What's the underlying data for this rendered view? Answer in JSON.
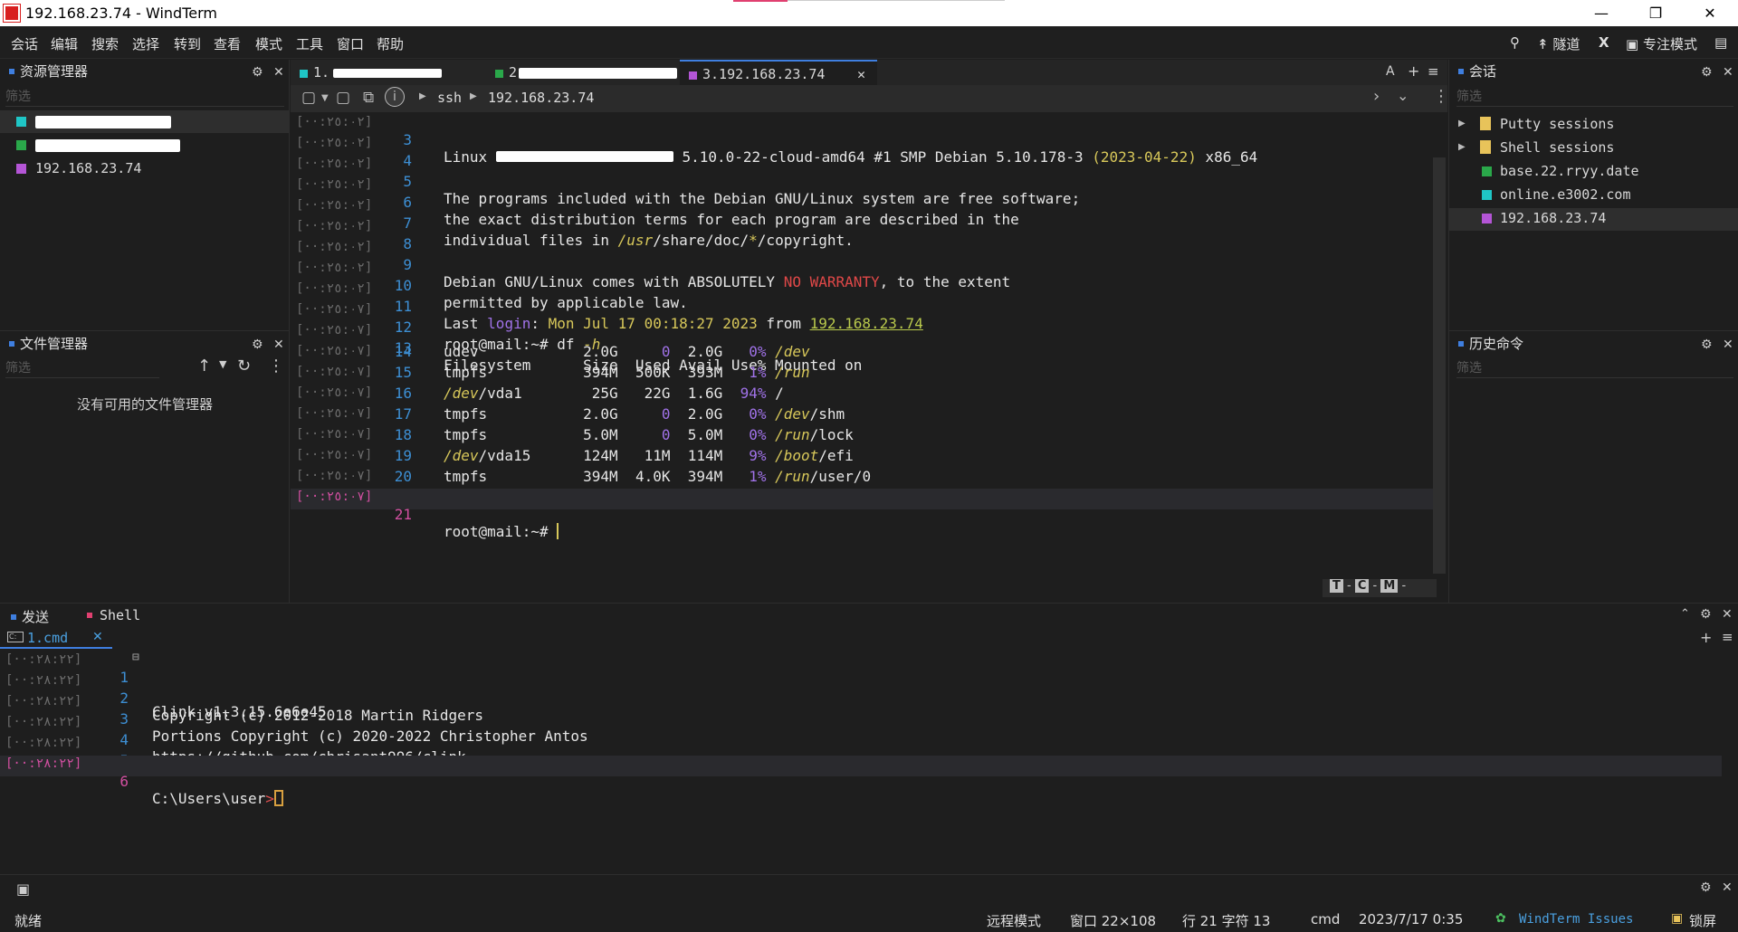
{
  "window": {
    "title": "192.168.23.74 - WindTerm"
  },
  "menu": [
    "会话",
    "编辑",
    "搜索",
    "选择",
    "转到",
    "查看",
    "模式",
    "工具",
    "窗口",
    "帮助"
  ],
  "toolbar": {
    "tunnel": "隧道",
    "x": "X",
    "focus_mode": "专注模式"
  },
  "explorer": {
    "title": "资源管理器",
    "filter": "筛选",
    "items": [
      {
        "label": "",
        "color": "#1fc6c6"
      },
      {
        "label": "",
        "color": "#2aa84a"
      },
      {
        "label": "192.168.23.74",
        "color": "#b455d6"
      }
    ]
  },
  "file_manager": {
    "title": "文件管理器",
    "filter": "筛选",
    "empty": "没有可用的文件管理器"
  },
  "tabs": [
    {
      "label": "1.",
      "color": "#1fc6c6"
    },
    {
      "label": "2",
      "color": "#2aa84a"
    },
    {
      "label": "3.192.168.23.74",
      "color": "#b455d6"
    }
  ],
  "tab_actions": {
    "font": "A",
    "add": "+",
    "menu": "≡",
    "close": "✕"
  },
  "breadcrumb": {
    "protocol": "ssh",
    "host": "192.168.23.74"
  },
  "terminal": {
    "lines": [
      {
        "ts": "[··:٢٥:٠٢]",
        "n": "3"
      },
      {
        "ts": "[··:٢٥:٠٢]",
        "n": "4"
      },
      {
        "ts": "[··:٢٥:٠٢]",
        "n": "5",
        "text": "The programs included with the Debian GNU/Linux system are free software;"
      },
      {
        "ts": "[··:٢٥:٠٢]",
        "n": "6",
        "text": "the exact distribution terms for each program are described in the"
      },
      {
        "ts": "[··:٢٥:٠٢]",
        "n": "7"
      },
      {
        "ts": "[··:٢٥:٠٢]",
        "n": "8"
      },
      {
        "ts": "[··:٢٥:٠٢]",
        "n": "9"
      },
      {
        "ts": "[··:٢٥:٠٢]",
        "n": "10",
        "text": "permitted by applicable law."
      },
      {
        "ts": "[··:٢٥:٠٢]",
        "n": "11"
      },
      {
        "ts": "[··:٢٥:٠٧]",
        "n": "12"
      },
      {
        "ts": "[··:٢٥:٠٧]",
        "n": "13",
        "text": "Filesystem      Size  Used Avail Use% Mounted on"
      },
      {
        "ts": "[··:٢٥:٠٧]",
        "n": "14"
      },
      {
        "ts": "[··:٢٥:٠٧]",
        "n": "15"
      },
      {
        "ts": "[··:٢٥:٠٧]",
        "n": "16"
      },
      {
        "ts": "[··:٢٥:٠٧]",
        "n": "17"
      },
      {
        "ts": "[··:٢٥:٠٧]",
        "n": "18"
      },
      {
        "ts": "[··:٢٥:٠٧]",
        "n": "19"
      },
      {
        "ts": "[··:٢٥:٠٧]",
        "n": "20"
      },
      {
        "ts": "[··:٢٥:٠٧]",
        "n": "21",
        "text": "root@mail:~# "
      }
    ],
    "linux_line": {
      "pre": "Linux",
      "kernel": "5.10.0-22-cloud-amd64",
      "build": "#1",
      "smp": "SMP Debian 5.10.178-3",
      "date": "(2023-04-22)",
      "arch": "x86_64"
    },
    "line7": {
      "a": "individual files in ",
      "b": "/usr",
      "c": "/share/doc/",
      "d": "*",
      "e": "/copyright."
    },
    "line9": {
      "a": "Debian GNU/Linux comes with ABSOLUTELY ",
      "b": "NO WARRANTY",
      "c": ", to the extent"
    },
    "line11": {
      "a": "Last ",
      "b": "login",
      "c": ": ",
      "d": "Mon Jul 17 00:18:27 2023",
      "e": " from ",
      "f": "192.168.23.74"
    },
    "line12": {
      "a": "root@mail:~# df ",
      "b": "-h"
    },
    "df_rows": [
      {
        "fs1": "udev",
        "fs2": "",
        "size": "2.0G",
        "used": "0",
        "avail": "2.0G",
        "use": "0%",
        "m1": "/dev",
        "m2": ""
      },
      {
        "fs1": "tmpfs",
        "fs2": "",
        "size": "394M",
        "used": "500K",
        "avail": "393M",
        "use": "1%",
        "m1": "/run",
        "m2": ""
      },
      {
        "fs1": "/dev",
        "fs2": "/vda1",
        "size": "25G",
        "used": "22G",
        "avail": "1.6G",
        "use": "94%",
        "m1": "",
        "m2": "/"
      },
      {
        "fs1": "tmpfs",
        "fs2": "",
        "size": "2.0G",
        "used": "0",
        "avail": "2.0G",
        "use": "0%",
        "m1": "/dev",
        "m2": "/shm"
      },
      {
        "fs1": "tmpfs",
        "fs2": "",
        "size": "5.0M",
        "used": "0",
        "avail": "5.0M",
        "use": "0%",
        "m1": "/run",
        "m2": "/lock"
      },
      {
        "fs1": "/dev",
        "fs2": "/vda15",
        "size": "124M",
        "used": "11M",
        "avail": "114M",
        "use": "9%",
        "m1": "/boot",
        "m2": "/efi"
      },
      {
        "fs1": "tmpfs",
        "fs2": "",
        "size": "394M",
        "used": "4.0K",
        "avail": "394M",
        "use": "1%",
        "m1": "/run",
        "m2": "/user/0"
      }
    ],
    "mode_letters": [
      "T",
      "C",
      "M"
    ]
  },
  "sessions": {
    "title": "会话",
    "filter": "筛选",
    "groups": [
      "Putty sessions",
      "Shell sessions"
    ],
    "items": [
      {
        "label": "base.22.rryy.date",
        "color": "#2aa84a"
      },
      {
        "label": "online.e3002.com",
        "color": "#1fc6c6"
      },
      {
        "label": "192.168.23.74",
        "color": "#b455d6"
      }
    ]
  },
  "history": {
    "title": "历史命令",
    "filter": "筛选"
  },
  "bottom": {
    "tabs": [
      "发送",
      "Shell"
    ],
    "file_tab": "1.cmd",
    "lines": [
      {
        "ts": "[··:٢٨:٢٢]",
        "n": "1",
        "text": "Clink v1.3.15.6e6e45"
      },
      {
        "ts": "[··:٢٨:٢٢]",
        "n": "2",
        "text": "Copyright (c) 2012-2018 Martin Ridgers"
      },
      {
        "ts": "[··:٢٨:٢٢]",
        "n": "3",
        "text": "Portions Copyright (c) 2020-2022 Christopher Antos"
      },
      {
        "ts": "[··:٢٨:٢٢]",
        "n": "4",
        "text": "https://github.com/chrisant996/clink"
      },
      {
        "ts": "[··:٢٨:٢٢]",
        "n": "5",
        "text": ""
      },
      {
        "ts": "[··:٢٨:٢٢]",
        "n": "6",
        "text": "C:\\Users\\user"
      }
    ],
    "prompt_char": ">"
  },
  "status": {
    "ready": "就绪",
    "remote_mode": "远程模式",
    "window_size": "窗口 22×108",
    "position": "行 21 字符 13",
    "shell": "cmd",
    "datetime": "2023/7/17 0:35",
    "issues": "WindTerm Issues",
    "lock": "锁屏"
  }
}
